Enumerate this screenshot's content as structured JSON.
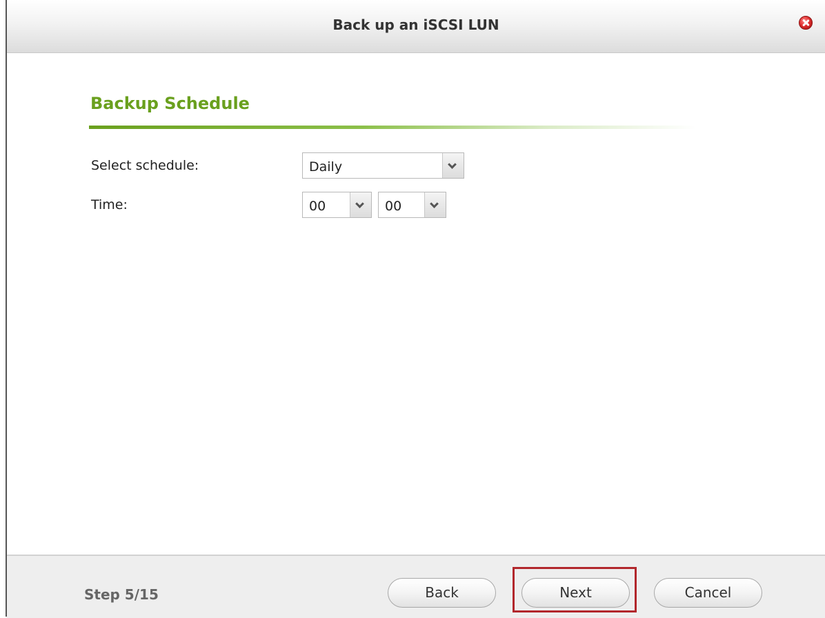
{
  "window": {
    "title": "Back up an iSCSI LUN",
    "close_icon": "close-icon"
  },
  "section": {
    "title": "Backup Schedule",
    "accent_color": "#6aa01e"
  },
  "form": {
    "schedule_label": "Select schedule:",
    "schedule_value": "Daily",
    "time_label": "Time:",
    "hour_value": "00",
    "minute_value": "00"
  },
  "footer": {
    "step": "Step 5/15",
    "back_label": "Back",
    "next_label": "Next",
    "cancel_label": "Cancel",
    "highlight_color": "#b2272c"
  }
}
